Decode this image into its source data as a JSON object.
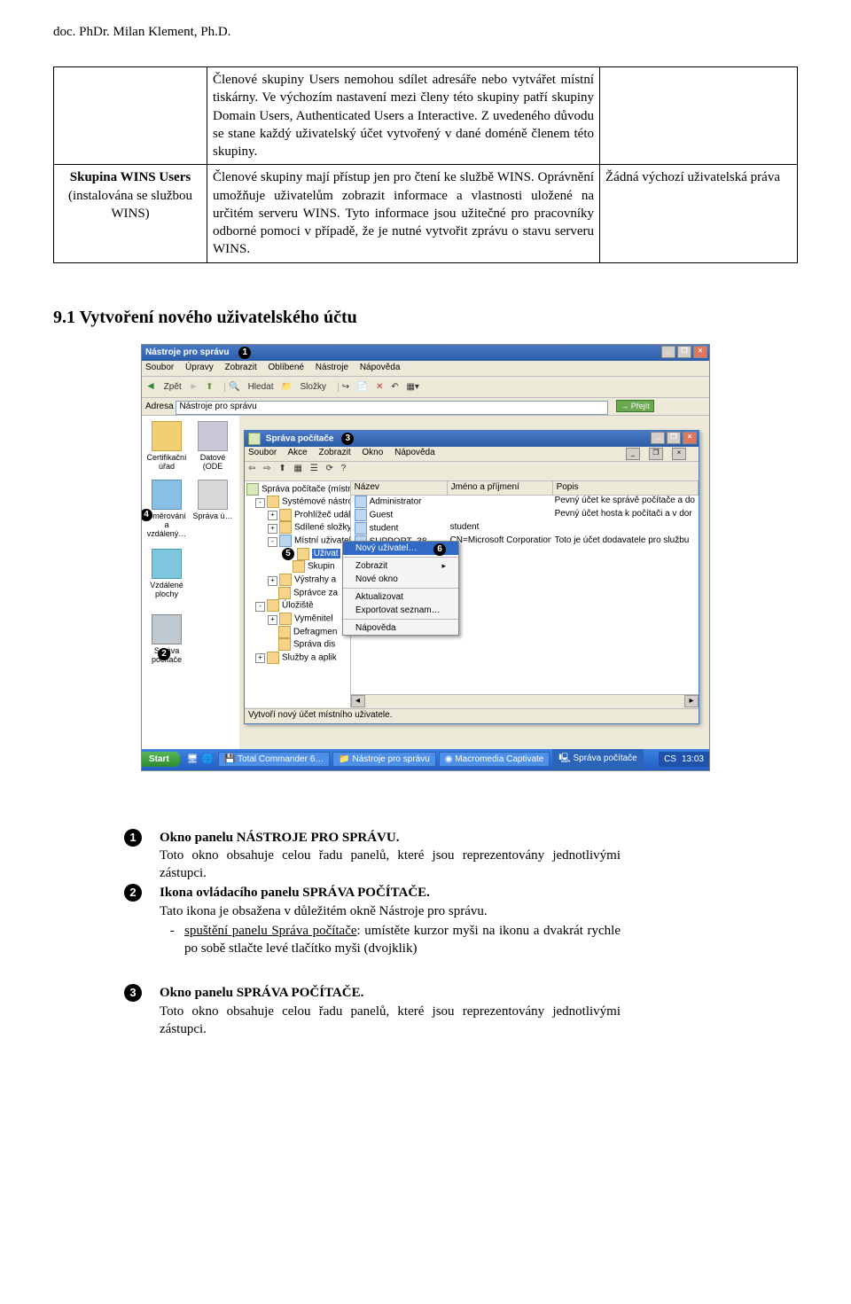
{
  "header": "doc. PhDr. Milan Klement, Ph.D.",
  "table": {
    "row1": {
      "col1": "",
      "col2": "Členové skupiny Users nemohou sdílet adresáře nebo vytvářet místní tiskárny. Ve výchozím nastavení mezi členy této skupiny patří skupiny Domain Users, Authenticated Users a Interactive. Z uvedeného důvodu se stane každý uživatelský účet vytvořený v dané doméně členem této skupiny.",
      "col3": ""
    },
    "row2": {
      "col1a": "Skupina WINS Users",
      "col1b": "(instalována se službou WINS)",
      "col2": "Členové skupiny mají přístup jen pro čtení ke službě WINS. Oprávnění umožňuje uživatelům zobrazit informace a vlastnosti uložené na určitém serveru WINS. Tyto informace jsou užitečné pro pracovníky odborné pomoci v případě, že je nutné vytvořit zprávu o stavu serveru WINS.",
      "col3": "Žádná výchozí uživatelská práva"
    }
  },
  "section_heading": "9.1 Vytvoření nového uživatelského účtu",
  "screenshot": {
    "explorer": {
      "title": "Nástroje pro správu",
      "menu": [
        "Soubor",
        "Úpravy",
        "Zobrazit",
        "Oblíbené",
        "Nástroje",
        "Nápověda"
      ],
      "toolbar": {
        "back": "Zpět",
        "search": "Hledat",
        "folders": "Složky"
      },
      "address_label": "Adresa",
      "address_value": "Nástroje pro správu",
      "go": "Přejít",
      "desktop": {
        "d1": "Certifikační úřad",
        "d2": "Datové (ODE",
        "d3": "Směrování a vzdálený…",
        "d4": "Správa ú…",
        "d5": "Vzdálené plochy",
        "d6": "Správa počítače"
      }
    },
    "mmc": {
      "title": "Správa počítače",
      "menu": [
        "Soubor",
        "Akce",
        "Zobrazit",
        "Okno",
        "Nápověda"
      ],
      "tree": {
        "root": "Správa počítače (místní)",
        "n1": "Systémové nástroje",
        "n2": "Prohlížeč událostí",
        "n3": "Sdílené složky",
        "n4": "Místní uživatelé a skupiny",
        "n5": "Uživat",
        "n6": "Skupin",
        "n7": "Výstrahy a",
        "n8": "Správce za",
        "n9": "Úložiště",
        "n10": "Vyměnitel",
        "n11": "Defragmen",
        "n12": "Správa dis",
        "n13": "Služby a aplik"
      },
      "list": {
        "h1": "Název",
        "h2": "Jméno a příjmení",
        "h3": "Popis",
        "rows": [
          {
            "c1": "Administrator",
            "c2": "",
            "c3": "Pevný účet ke správě počítače a do"
          },
          {
            "c1": "Guest",
            "c2": "",
            "c3": "Pevný účet hosta k počítači a v dor"
          },
          {
            "c1": "student",
            "c2": "student",
            "c3": ""
          },
          {
            "c1": "SUPPORT_38…",
            "c2": "CN=Microsoft Corporation…",
            "c3": "Toto je účet dodavatele pro službu"
          }
        ]
      },
      "context": {
        "i1": "Nový uživatel…",
        "i2": "Zobrazit",
        "i3": "Nové okno",
        "i4": "Aktualizovat",
        "i5": "Exportovat seznam…",
        "i6": "Nápověda"
      },
      "status": "Vytvoří nový účet místního uživatele."
    },
    "taskbar": {
      "start": "Start",
      "t1": "Total Commander 6…",
      "t2": "Nástroje pro správu",
      "t3": "Macromedia Captivate",
      "t4": "Správa počítače",
      "clock": "13:03"
    },
    "bullets": {
      "b1": "1",
      "b2": "2",
      "b3": "3",
      "b4": "4",
      "b5": "5",
      "b6": "6"
    }
  },
  "legend": {
    "i1_title": "Okno panelu NÁSTROJE PRO SPRÁVU.",
    "i1_body": "Toto okno obsahuje celou řadu panelů, které jsou reprezentovány jednotlivými zástupci.",
    "i2_title": "Ikona ovládacího panelu SPRÁVA POČÍTAČE.",
    "i2_body": "Tato ikona je obsažena v důležitém okně Nástroje pro správu.",
    "i2_li": "spuštění panelu Správa počítače: umístěte kurzor myši na ikonu a dvakrát rychle po sobě stlačte levé tlačítko myši (dvojklik)",
    "i2_li_label": "spuštění panelu Správa počítače",
    "i3_title": "Okno panelu SPRÁVA POČÍTAČE.",
    "i3_body": "Toto okno obsahuje celou řadu panelů, které jsou reprezentovány jednotlivými zástupci."
  }
}
